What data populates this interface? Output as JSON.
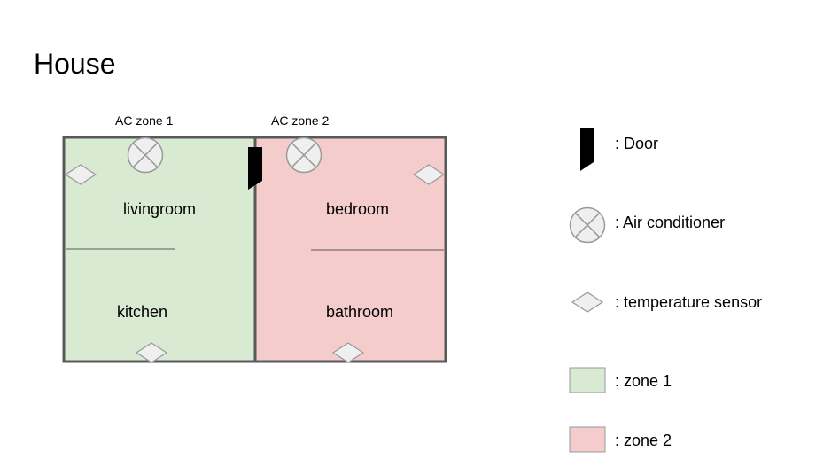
{
  "title": "House",
  "plan": {
    "ac_labels": [
      "AC zone 1",
      "AC zone 2"
    ],
    "rooms": {
      "livingroom": "livingroom",
      "kitchen": "kitchen",
      "bedroom": "bedroom",
      "bathroom": "bathroom"
    }
  },
  "legend": {
    "door": ": Door",
    "air_conditioner": ": Air conditioner",
    "temperature_sensor": ": temperature sensor",
    "zone1": ": zone 1",
    "zone2": ": zone 2"
  },
  "colors": {
    "zone1": "#d9ead3",
    "zone2": "#f4cccc",
    "wall": "#595959",
    "device_fill": "#efefef",
    "device_stroke": "#999999",
    "door": "#000000"
  }
}
